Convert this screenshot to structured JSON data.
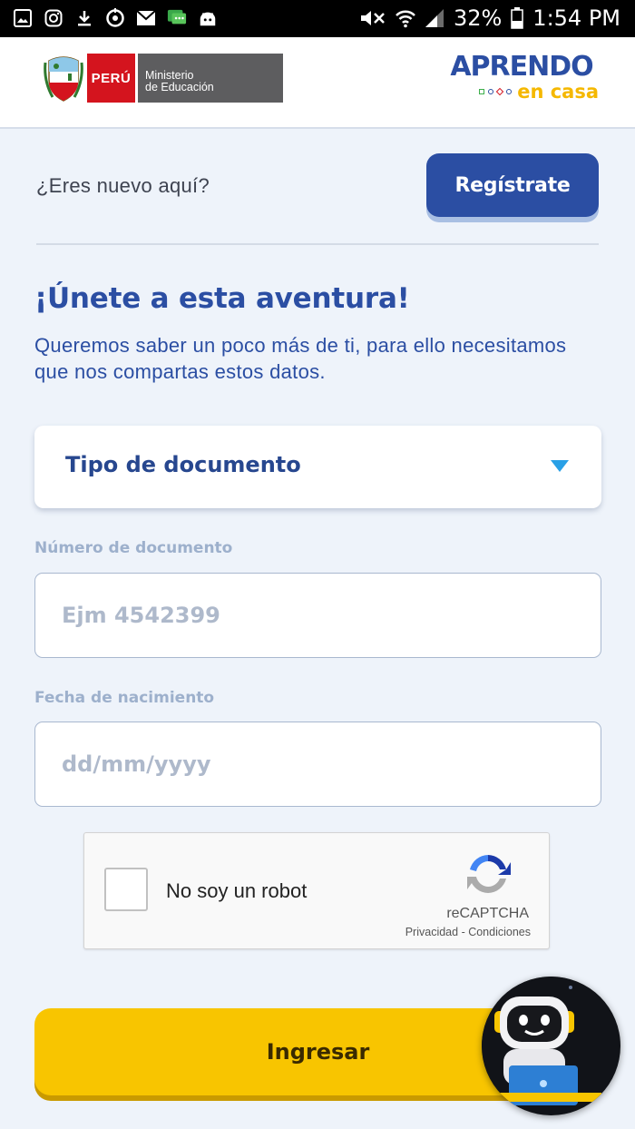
{
  "status_bar": {
    "battery_percent": "32%",
    "time": "1:54 PM",
    "icons_left": [
      "image-icon",
      "instagram-icon",
      "download-icon",
      "sync-icon",
      "mail-icon",
      "chat-icon",
      "android-icon"
    ],
    "icons_right": [
      "mute-icon",
      "wifi-icon",
      "signal-icon",
      "battery-icon"
    ]
  },
  "header": {
    "peru_label": "PERÚ",
    "ministry_line1": "Ministerio",
    "ministry_line2": "de Educación",
    "app_name_top": "APRENDO",
    "app_name_bottom": "en casa"
  },
  "register": {
    "question": "¿Eres nuevo aquí?",
    "button_label": "Regístrate"
  },
  "form": {
    "title": "¡Únete a esta aventura!",
    "subtitle": "Queremos saber un poco más de ti, para ello necesitamos que nos compartas estos datos.",
    "document_type": {
      "label": "Tipo de documento"
    },
    "document_number": {
      "label": "Número de documento",
      "placeholder": "Ejm 4542399",
      "value": ""
    },
    "birth_date": {
      "label": "Fecha de nacimiento",
      "placeholder": "dd/mm/yyyy",
      "value": ""
    },
    "submit_label": "Ingresar"
  },
  "recaptcha": {
    "label": "No soy un robot",
    "brand": "reCAPTCHA",
    "privacy": "Privacidad",
    "separator": " - ",
    "terms": "Condiciones"
  },
  "colors": {
    "primary_blue": "#2b4ea3",
    "accent_yellow": "#f8c500",
    "background": "#eef3fa",
    "peru_red": "#d4141e"
  }
}
